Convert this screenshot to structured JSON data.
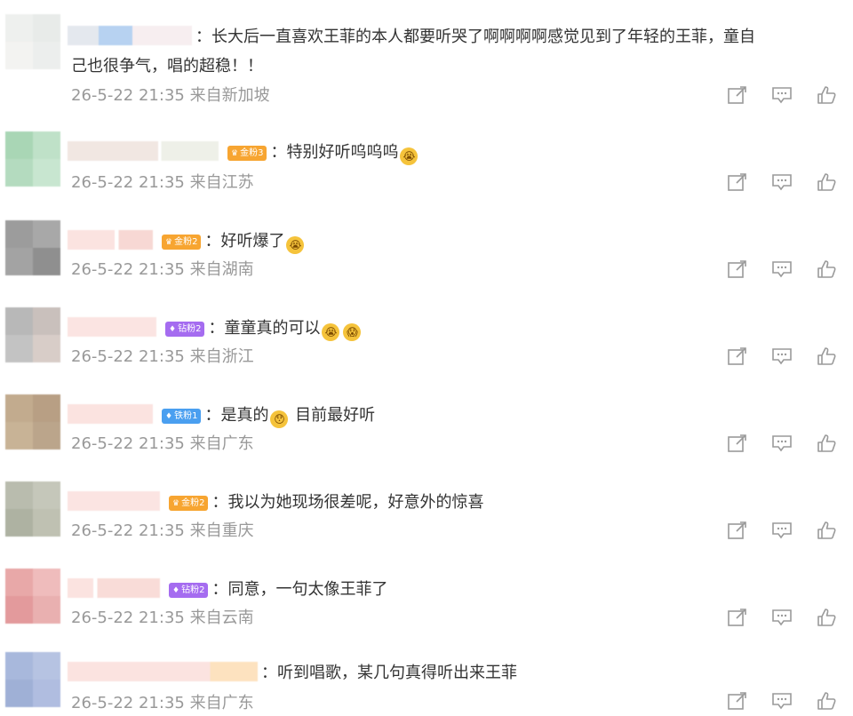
{
  "comments": [
    {
      "text": "：长大后一直喜欢王菲的本人都要听哭了啊啊啊啊感觉见到了年轻的王菲，童自",
      "text2": "己也很争气，唱的超稳！！",
      "meta": "26-5-22 21:35 来自新加坡",
      "badge": ""
    },
    {
      "text": "：特别好听呜呜呜",
      "meta": "26-5-22 21:35 来自江苏",
      "badge": "金粉3"
    },
    {
      "text": "：好听爆了",
      "meta": "26-5-22 21:35 来自湖南",
      "badge": "金粉2"
    },
    {
      "text": "：童童真的可以",
      "meta": "26-5-22 21:35 来自浙江",
      "badge": "钻粉2"
    },
    {
      "text": "：是真的",
      "text_after": " 目前最好听",
      "meta": "26-5-22 21:35 来自广东",
      "badge": "铁粉1"
    },
    {
      "text": "：我以为她现场很差呢，好意外的惊喜",
      "meta": "26-5-22 21:35 来自重庆",
      "badge": "金粉2"
    },
    {
      "text": "：同意，一句太像王菲了",
      "meta": "26-5-22 21:35 来自云南",
      "badge": "钻粉2"
    },
    {
      "text": "：听到唱歌，某几句真得听出来王菲",
      "meta": "26-5-22 21:35 来自广东",
      "badge": ""
    }
  ],
  "icons": {
    "share": "share-icon",
    "comment": "comment-icon",
    "like": "like-icon"
  },
  "colors": {
    "meta": "#999999",
    "text": "#333333",
    "gold_badge": "#f7a531",
    "diamond_badge": "#a56cf0",
    "iron_badge": "#4a9ff0"
  }
}
